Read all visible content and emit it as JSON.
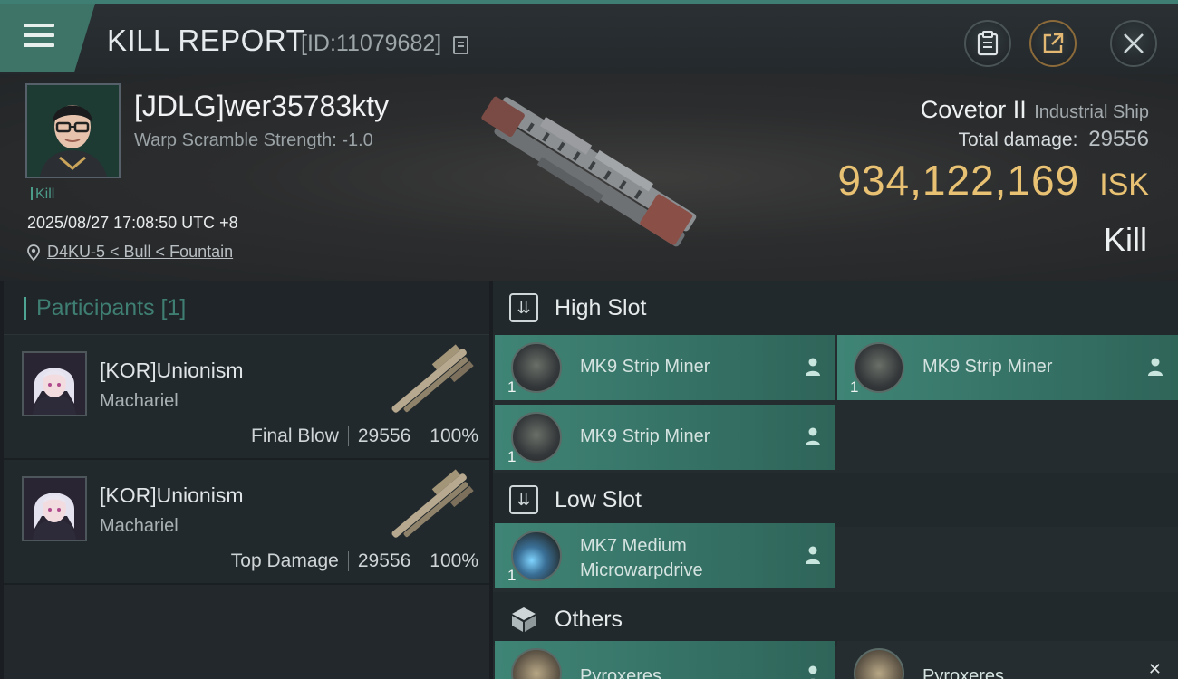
{
  "topbar": {
    "title": "KILL REPORT",
    "report_id": "[ID:11079682]"
  },
  "victim": {
    "name": "[JDLG]wer35783kty",
    "warp_scramble": "Warp Scramble Strength: -1.0",
    "kill_tag": "Kill",
    "datetime": "2025/08/27 17:08:50 UTC +8",
    "location": "D4KU-5 < Bull < Fountain",
    "ship_name": "Covetor II",
    "ship_class": "Industrial Ship",
    "total_damage_label": "Total damage:",
    "total_damage": "29556",
    "isk_value": "934,122,169",
    "isk_unit": "ISK",
    "result": "Kill"
  },
  "participants": {
    "header": "Participants [1]",
    "items": [
      {
        "name": "[KOR]Unionism",
        "ship": "Machariel",
        "role": "Final Blow",
        "damage": "29556",
        "percent": "100%"
      },
      {
        "name": "[KOR]Unionism",
        "ship": "Machariel",
        "role": "Top Damage",
        "damage": "29556",
        "percent": "100%"
      }
    ]
  },
  "slots": {
    "high": {
      "label": "High Slot",
      "modules": [
        {
          "name": "MK9 Strip Miner",
          "qty": "1"
        },
        {
          "name": "MK9 Strip Miner",
          "qty": "1"
        },
        {
          "name": "MK9 Strip Miner",
          "qty": "1"
        }
      ]
    },
    "low": {
      "label": "Low Slot",
      "modules": [
        {
          "name_line1": "MK7 Medium",
          "name_line2": "Microwarpdrive",
          "qty": "1"
        }
      ]
    },
    "others": {
      "label": "Others",
      "modules": [
        {
          "name": "Pyroxeres"
        },
        {
          "name": "Pyroxeres"
        }
      ]
    }
  },
  "colors": {
    "accent_teal": "#3f8576",
    "isk_gold": "#e8c173"
  }
}
